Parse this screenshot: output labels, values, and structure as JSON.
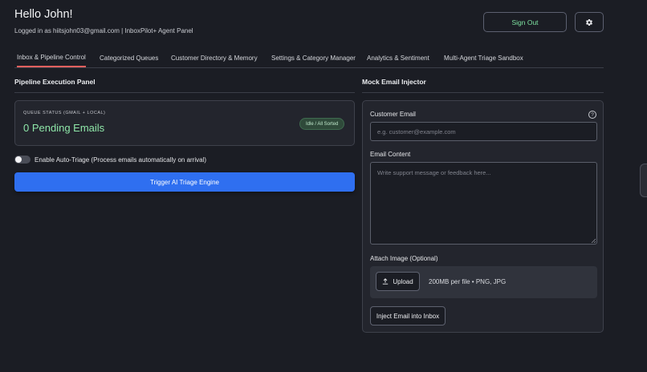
{
  "header": {
    "greeting": "Hello John!",
    "subline": "Logged in as hiitsjohn03@gmail.com | InboxPilot+ Agent Panel",
    "signout_label": "Sign Out",
    "settings_icon": "gear-icon"
  },
  "tabs": [
    {
      "label": "Inbox & Pipeline Control",
      "active": true
    },
    {
      "label": "Categorized Queues",
      "active": false
    },
    {
      "label": "Customer Directory & Memory",
      "active": false
    },
    {
      "label": "Settings & Category Manager",
      "active": false
    },
    {
      "label": "Analytics & Sentiment",
      "active": false
    },
    {
      "label": "Multi-Agent Triage Sandbox",
      "active": false
    }
  ],
  "pipeline": {
    "title": "Pipeline Execution Panel",
    "queue_label": "QUEUE STATUS (GMAIL + LOCAL)",
    "pending": "0 Pending Emails",
    "status_badge": "Idle / All Sorted",
    "auto_triage_label": "Enable Auto-Triage (Process emails automatically on arrival)",
    "auto_triage_on": false,
    "trigger_label": "Trigger AI Triage Engine"
  },
  "injector": {
    "title": "Mock Email Injector",
    "email_label": "Customer Email",
    "email_placeholder": "e.g. customer@example.com",
    "email_value": "",
    "content_label": "Email Content",
    "content_placeholder": "Write support message or feedback here...",
    "content_value": "",
    "attach_label": "Attach Image (Optional)",
    "upload_label": "Upload",
    "upload_hint": "200MB per file • PNG, JPG",
    "inject_label": "Inject Email into Inbox"
  },
  "colors": {
    "background": "#1b1d24",
    "accent_green": "#7ee3a1",
    "primary_blue": "#2f6ff0",
    "tab_active_underline": "#f0605e"
  }
}
